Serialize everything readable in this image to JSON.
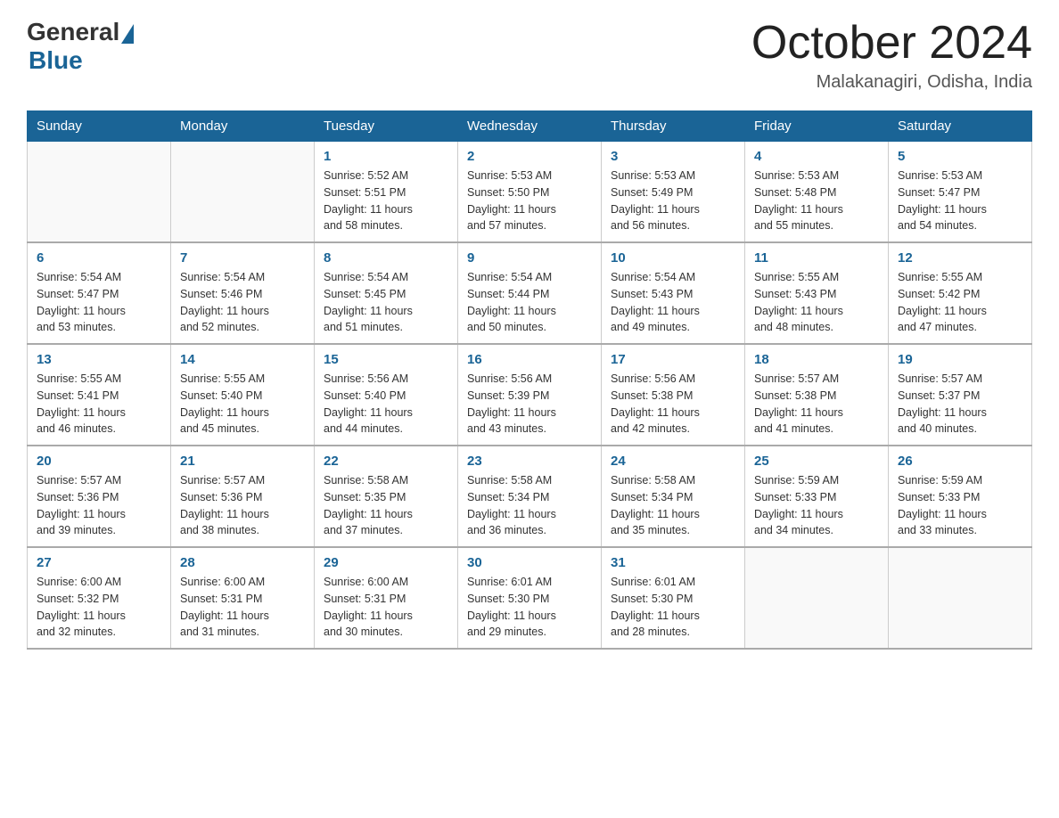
{
  "header": {
    "logo_general": "General",
    "logo_blue": "Blue",
    "month_title": "October 2024",
    "location": "Malakanagiri, Odisha, India"
  },
  "calendar": {
    "days_of_week": [
      "Sunday",
      "Monday",
      "Tuesday",
      "Wednesday",
      "Thursday",
      "Friday",
      "Saturday"
    ],
    "weeks": [
      [
        {
          "day": "",
          "info": ""
        },
        {
          "day": "",
          "info": ""
        },
        {
          "day": "1",
          "info": "Sunrise: 5:52 AM\nSunset: 5:51 PM\nDaylight: 11 hours\nand 58 minutes."
        },
        {
          "day": "2",
          "info": "Sunrise: 5:53 AM\nSunset: 5:50 PM\nDaylight: 11 hours\nand 57 minutes."
        },
        {
          "day": "3",
          "info": "Sunrise: 5:53 AM\nSunset: 5:49 PM\nDaylight: 11 hours\nand 56 minutes."
        },
        {
          "day": "4",
          "info": "Sunrise: 5:53 AM\nSunset: 5:48 PM\nDaylight: 11 hours\nand 55 minutes."
        },
        {
          "day": "5",
          "info": "Sunrise: 5:53 AM\nSunset: 5:47 PM\nDaylight: 11 hours\nand 54 minutes."
        }
      ],
      [
        {
          "day": "6",
          "info": "Sunrise: 5:54 AM\nSunset: 5:47 PM\nDaylight: 11 hours\nand 53 minutes."
        },
        {
          "day": "7",
          "info": "Sunrise: 5:54 AM\nSunset: 5:46 PM\nDaylight: 11 hours\nand 52 minutes."
        },
        {
          "day": "8",
          "info": "Sunrise: 5:54 AM\nSunset: 5:45 PM\nDaylight: 11 hours\nand 51 minutes."
        },
        {
          "day": "9",
          "info": "Sunrise: 5:54 AM\nSunset: 5:44 PM\nDaylight: 11 hours\nand 50 minutes."
        },
        {
          "day": "10",
          "info": "Sunrise: 5:54 AM\nSunset: 5:43 PM\nDaylight: 11 hours\nand 49 minutes."
        },
        {
          "day": "11",
          "info": "Sunrise: 5:55 AM\nSunset: 5:43 PM\nDaylight: 11 hours\nand 48 minutes."
        },
        {
          "day": "12",
          "info": "Sunrise: 5:55 AM\nSunset: 5:42 PM\nDaylight: 11 hours\nand 47 minutes."
        }
      ],
      [
        {
          "day": "13",
          "info": "Sunrise: 5:55 AM\nSunset: 5:41 PM\nDaylight: 11 hours\nand 46 minutes."
        },
        {
          "day": "14",
          "info": "Sunrise: 5:55 AM\nSunset: 5:40 PM\nDaylight: 11 hours\nand 45 minutes."
        },
        {
          "day": "15",
          "info": "Sunrise: 5:56 AM\nSunset: 5:40 PM\nDaylight: 11 hours\nand 44 minutes."
        },
        {
          "day": "16",
          "info": "Sunrise: 5:56 AM\nSunset: 5:39 PM\nDaylight: 11 hours\nand 43 minutes."
        },
        {
          "day": "17",
          "info": "Sunrise: 5:56 AM\nSunset: 5:38 PM\nDaylight: 11 hours\nand 42 minutes."
        },
        {
          "day": "18",
          "info": "Sunrise: 5:57 AM\nSunset: 5:38 PM\nDaylight: 11 hours\nand 41 minutes."
        },
        {
          "day": "19",
          "info": "Sunrise: 5:57 AM\nSunset: 5:37 PM\nDaylight: 11 hours\nand 40 minutes."
        }
      ],
      [
        {
          "day": "20",
          "info": "Sunrise: 5:57 AM\nSunset: 5:36 PM\nDaylight: 11 hours\nand 39 minutes."
        },
        {
          "day": "21",
          "info": "Sunrise: 5:57 AM\nSunset: 5:36 PM\nDaylight: 11 hours\nand 38 minutes."
        },
        {
          "day": "22",
          "info": "Sunrise: 5:58 AM\nSunset: 5:35 PM\nDaylight: 11 hours\nand 37 minutes."
        },
        {
          "day": "23",
          "info": "Sunrise: 5:58 AM\nSunset: 5:34 PM\nDaylight: 11 hours\nand 36 minutes."
        },
        {
          "day": "24",
          "info": "Sunrise: 5:58 AM\nSunset: 5:34 PM\nDaylight: 11 hours\nand 35 minutes."
        },
        {
          "day": "25",
          "info": "Sunrise: 5:59 AM\nSunset: 5:33 PM\nDaylight: 11 hours\nand 34 minutes."
        },
        {
          "day": "26",
          "info": "Sunrise: 5:59 AM\nSunset: 5:33 PM\nDaylight: 11 hours\nand 33 minutes."
        }
      ],
      [
        {
          "day": "27",
          "info": "Sunrise: 6:00 AM\nSunset: 5:32 PM\nDaylight: 11 hours\nand 32 minutes."
        },
        {
          "day": "28",
          "info": "Sunrise: 6:00 AM\nSunset: 5:31 PM\nDaylight: 11 hours\nand 31 minutes."
        },
        {
          "day": "29",
          "info": "Sunrise: 6:00 AM\nSunset: 5:31 PM\nDaylight: 11 hours\nand 30 minutes."
        },
        {
          "day": "30",
          "info": "Sunrise: 6:01 AM\nSunset: 5:30 PM\nDaylight: 11 hours\nand 29 minutes."
        },
        {
          "day": "31",
          "info": "Sunrise: 6:01 AM\nSunset: 5:30 PM\nDaylight: 11 hours\nand 28 minutes."
        },
        {
          "day": "",
          "info": ""
        },
        {
          "day": "",
          "info": ""
        }
      ]
    ]
  }
}
